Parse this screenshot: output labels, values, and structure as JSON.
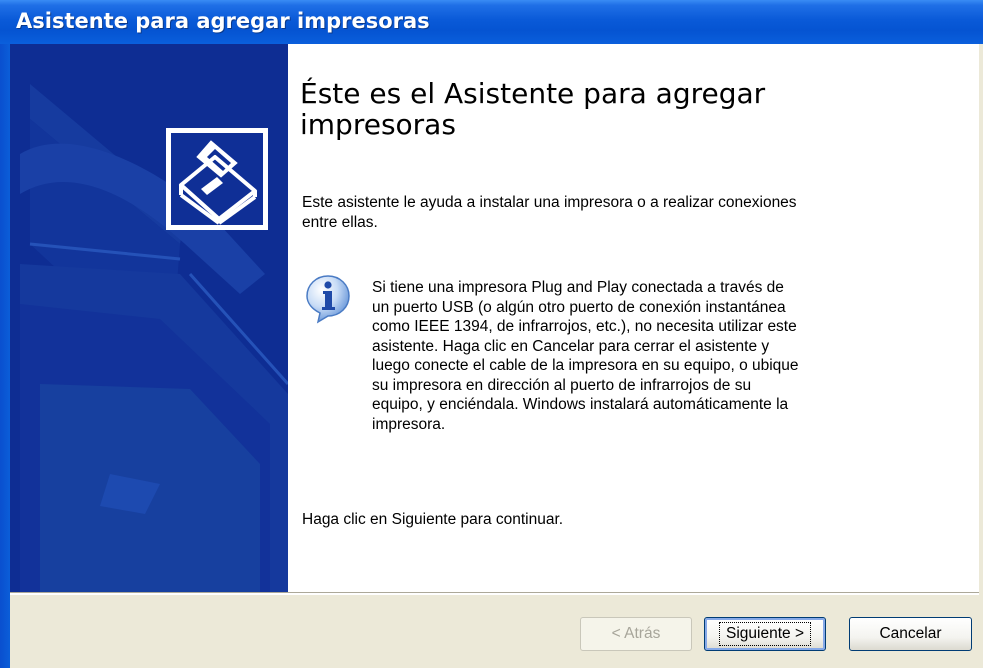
{
  "window": {
    "title": "Asistente para agregar impresoras"
  },
  "content": {
    "heading": "Éste es el Asistente para agregar impresoras",
    "intro": "Este asistente le ayuda a instalar una impresora o a realizar conexiones entre ellas.",
    "info": "Si tiene una impresora Plug and Play conectada a través de un puerto USB (o algún otro puerto de conexión instantánea como IEEE 1394, de infrarrojos, etc.), no necesita utilizar este asistente. Haga clic en Cancelar para cerrar el asistente y luego conecte el cable de la impresora en su equipo, o ubique su impresora en dirección al puerto de infrarrojos de su equipo, y enciéndala. Windows instalará automáticamente la impresora.",
    "continue": "Haga clic en Siguiente para continuar."
  },
  "buttons": {
    "back": "< Atrás",
    "next": "Siguiente >",
    "cancel": "Cancelar"
  },
  "icons": {
    "wizard_logo": "printer-icon",
    "info": "info-icon",
    "side_art": "printer-watermark-icon"
  },
  "colors": {
    "title_bar": "#0554d2",
    "side_panel": "#0e2d93",
    "dialog_bg": "#ece9d8"
  }
}
